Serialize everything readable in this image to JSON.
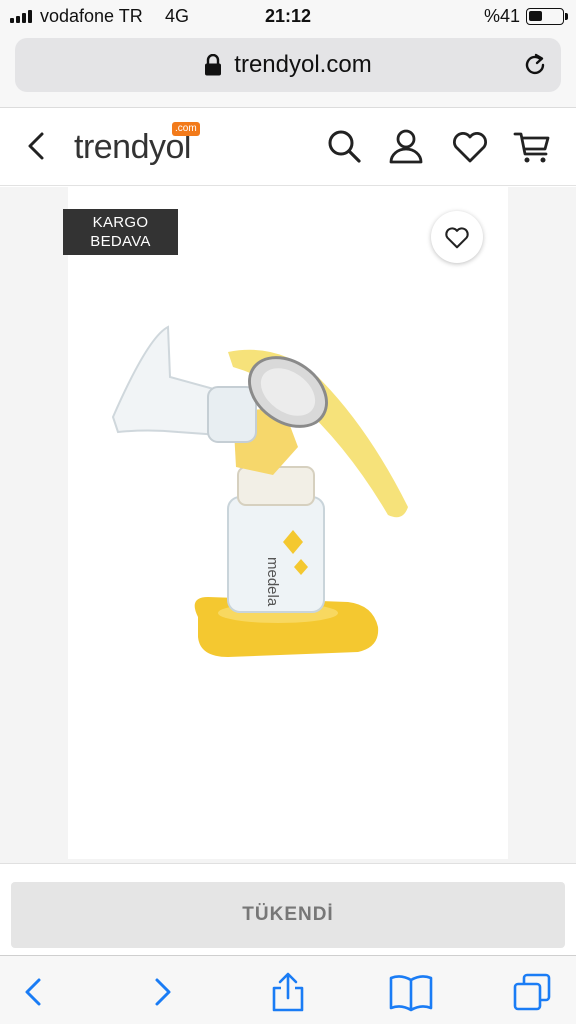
{
  "status_bar": {
    "carrier": "vodafone TR",
    "network": "4G",
    "time": "21:12",
    "battery_text": "%41",
    "battery_level": 0.41
  },
  "browser": {
    "url": "trendyol.com"
  },
  "header": {
    "logo_text": "trendyol",
    "logo_badge": ".com",
    "brand_color": "#f27a1a"
  },
  "product": {
    "badge_line1": "KARGO",
    "badge_line2": "BEDAVA",
    "bottle_brand": "medela"
  },
  "actions": {
    "sold_out_label": "TÜKENDİ"
  },
  "icons": {
    "header": [
      "back-icon",
      "search-icon",
      "user-icon",
      "heart-icon",
      "cart-icon"
    ],
    "toolbar": [
      "back-arrow-icon",
      "forward-arrow-icon",
      "share-icon",
      "bookmarks-icon",
      "tabs-icon"
    ],
    "accent": "#1a7cf5"
  }
}
